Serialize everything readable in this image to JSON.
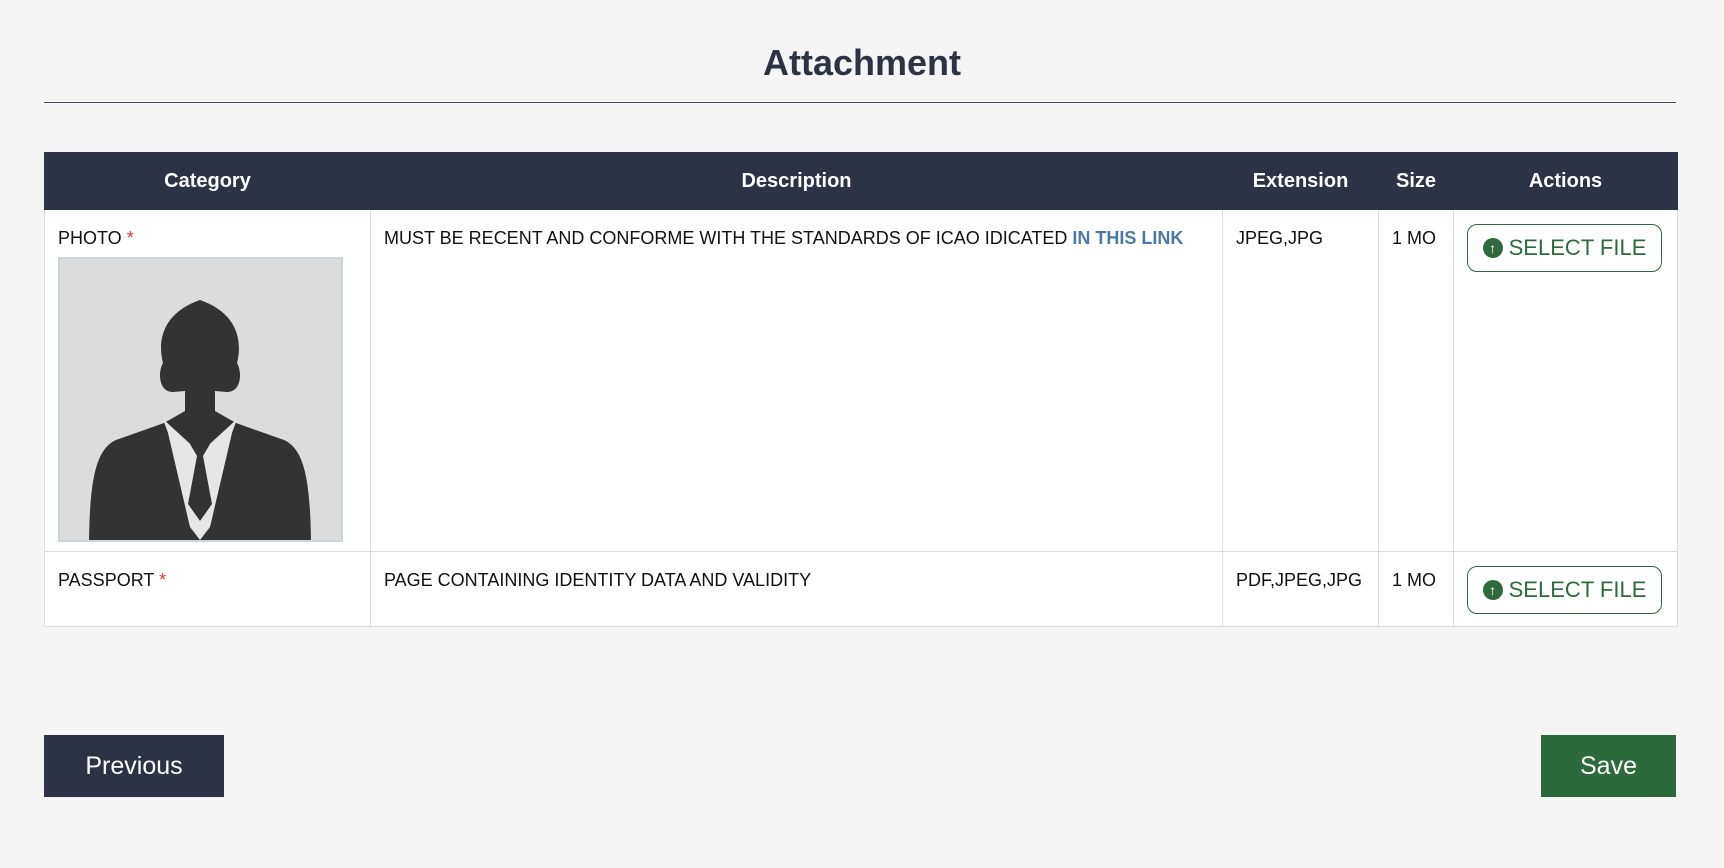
{
  "page": {
    "title": "Attachment"
  },
  "table": {
    "headers": {
      "category": "Category",
      "description": "Description",
      "extension": "Extension",
      "size": "Size",
      "actions": "Actions"
    },
    "rows": [
      {
        "category": "PHOTO",
        "required_mark": "*",
        "description": "MUST BE RECENT AND CONFORME WITH THE STANDARDS OF ICAO IDICATED",
        "link_text": "IN THIS LINK",
        "extension": "JPEG,JPG",
        "size": "1 MO",
        "action_label": "SELECT FILE",
        "has_photo_placeholder": true
      },
      {
        "category": "PASSPORT",
        "required_mark": "*",
        "description": "PAGE CONTAINING IDENTITY DATA AND VALIDITY",
        "extension": "PDF,JPEG,JPG",
        "size": "1 MO",
        "action_label": "SELECT FILE"
      }
    ]
  },
  "footer": {
    "previous_label": "Previous",
    "save_label": "Save"
  },
  "icons": {
    "upload": "upload-arrow-circle-icon",
    "avatar": "person-silhouette-icon"
  },
  "colors": {
    "header_bg": "#2b3344",
    "accent_green": "#2a6a3c",
    "required_red": "#d03a3a",
    "link_blue": "#4a78a8"
  }
}
